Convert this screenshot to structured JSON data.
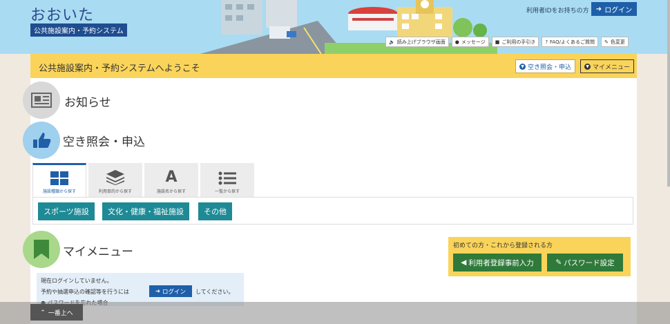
{
  "header": {
    "logo_main": "おおいた",
    "logo_sub": "公共施設案内・予約システム",
    "login_prompt": "利用者IDをお持ちの方",
    "login_label": "ログイン",
    "tools": [
      {
        "label": "読み上げブラウザ画面",
        "icon": "speaker-icon"
      },
      {
        "label": "メッセージ",
        "icon": "chat-icon"
      },
      {
        "label": "ご利用の手引き",
        "icon": "book-icon"
      },
      {
        "label": "FAQ/よくあるご質問",
        "icon": "question-icon"
      },
      {
        "label": "色変更",
        "icon": "brush-icon"
      }
    ]
  },
  "welcome": {
    "title": "公共施設案内・予約システムへようこそ",
    "vacancy_label": "空き照会・申込",
    "mymenu_label": "マイメニュー"
  },
  "sections": {
    "news_title": "お知らせ",
    "vacancy_title": "空き照会・申込",
    "mymenu_title": "マイメニュー"
  },
  "tabs": [
    {
      "label": "施設種類から探す",
      "icon": "grid-icon"
    },
    {
      "label": "利用目的から探す",
      "icon": "layers-icon"
    },
    {
      "label": "施設名から探す",
      "icon": "letter-a-icon"
    },
    {
      "label": "一覧から探す",
      "icon": "list-icon"
    }
  ],
  "categories": [
    "スポーツ施設",
    "文化・健康・福祉施設",
    "その他"
  ],
  "registration": {
    "title": "初めての方・これから登録される方",
    "pre_register_label": "利用者登録事前入力",
    "password_label": "パスワード設定"
  },
  "status": {
    "line1": "現在ログインしていません。",
    "line2_pre": "予約や抽選申込の確認等を行うには",
    "login_label": "ログイン",
    "line2_post": "してください。",
    "forgot": "パスワードを忘れた場合"
  },
  "to_top_label": "一番上へ",
  "colors": {
    "header_bg": "#a9dcf2",
    "accent_yellow": "#fad45a",
    "primary_blue": "#1f5fa8",
    "teal": "#1d8a96",
    "green": "#2f7a3a"
  }
}
